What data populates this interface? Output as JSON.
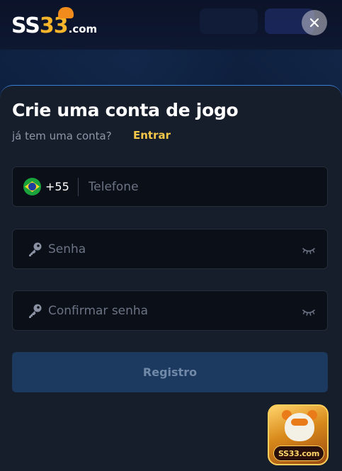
{
  "brand": {
    "logo_main": "SS",
    "logo_number": "33",
    "logo_suffix": ".com"
  },
  "modal": {
    "title": "Crie uma conta de jogo",
    "subtitle": "já tem uma conta?",
    "login_link": "Entrar",
    "phone": {
      "country_code": "+55",
      "flag_icon": "brazil-flag-icon",
      "placeholder": "Telefone",
      "value": ""
    },
    "password": {
      "placeholder": "Senha",
      "value": "",
      "icon": "key-icon",
      "toggle_icon": "eye-closed-icon"
    },
    "confirm_password": {
      "placeholder": "Confirmar senha",
      "value": "",
      "icon": "key-icon",
      "toggle_icon": "eye-closed-icon"
    },
    "register_button": "Registro"
  },
  "promo": {
    "badge": "SS33.com"
  },
  "colors": {
    "sheet_bg": "#161d2b",
    "field_bg": "#0b0f18",
    "accent_link": "#f5c84a",
    "register_bg": "#1c3a5f",
    "register_text": "#7189a8",
    "sheet_border": "#3a7fd6"
  }
}
